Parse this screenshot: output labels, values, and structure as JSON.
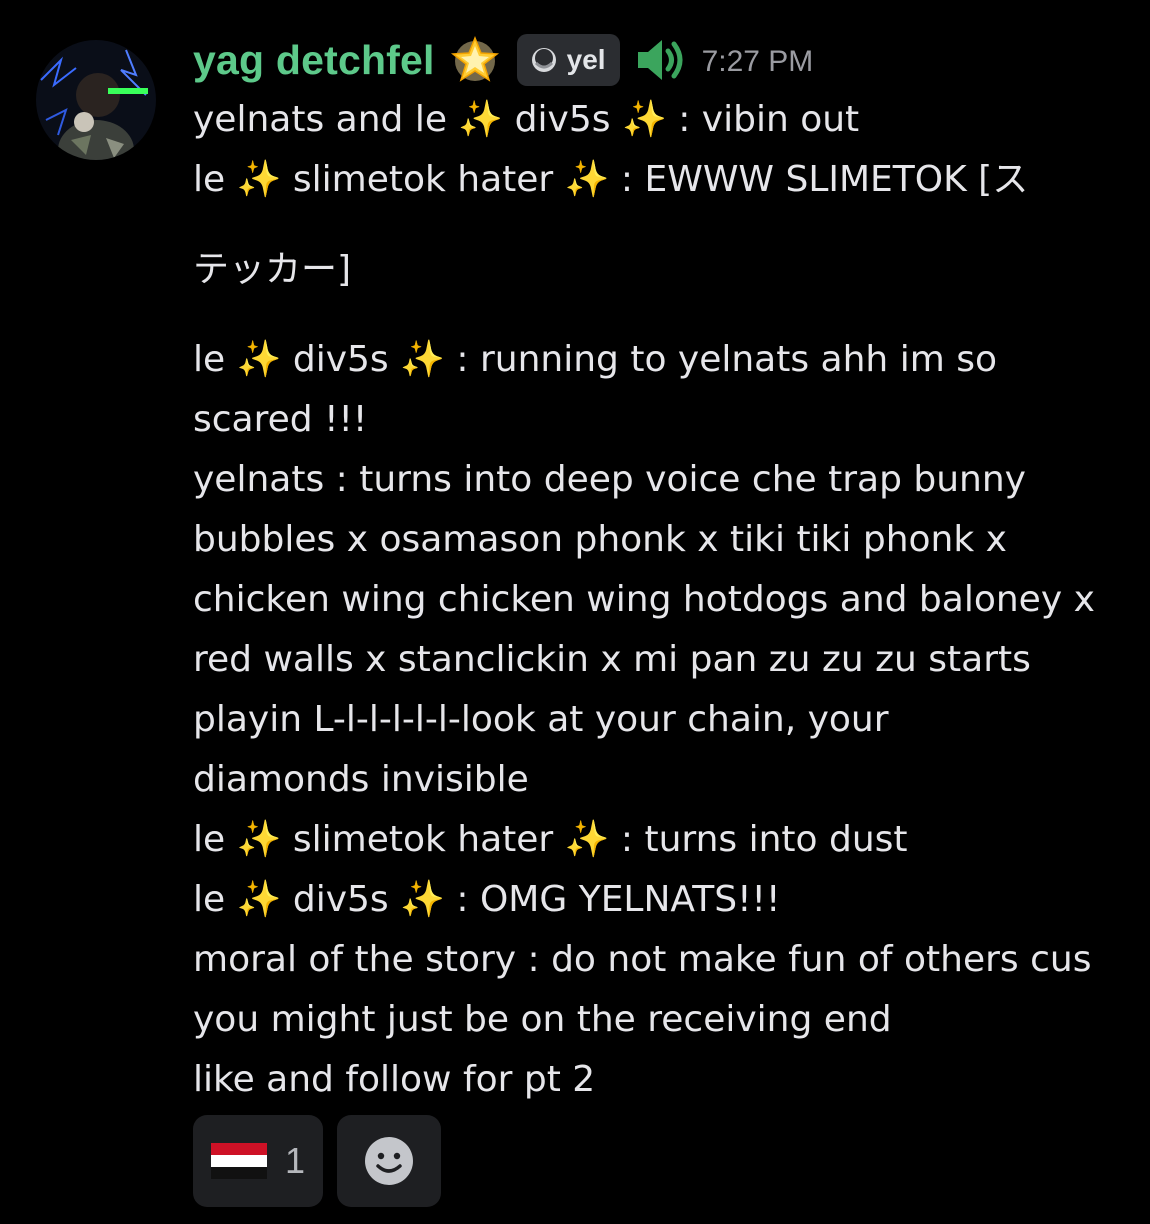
{
  "message": {
    "username": "yag detchfel",
    "username_color": "#5dc98a",
    "username_decoration_icon": "glowing-star-icon",
    "tag": {
      "icon": "guild-tag-icon",
      "label": "yel"
    },
    "status_icon": "speaker-icon",
    "timestamp": "7:27 PM",
    "lines": [
      "yelnats and le ✨ div5s ✨  : vibin out",
      "le ✨  slimetok hater ✨ : EWWW SLIMETOK [ス",
      "",
      "テッカー]",
      "",
      "le ✨ div5s ✨ : running to yelnats ahh im so",
      "scared !!!",
      "yelnats : turns into deep voice che trap bunny",
      "bubbles x osamason phonk x tiki tiki phonk x",
      "chicken wing chicken wing hotdogs and baloney x",
      "red walls x stanclickin x mi pan zu zu zu starts",
      "playin L-l-l-l-l-l-look at your chain, your",
      "diamonds invisible",
      "le ✨ slimetok hater ✨ : turns into dust",
      "le ✨ div5s ✨ : OMG YELNATS!!!",
      "moral of the story : do not make fun of others cus",
      "you might just be on the receiving end",
      "like and follow for pt 2"
    ]
  },
  "reactions": [
    {
      "icon": "yemen-flag-icon",
      "count": "1"
    },
    {
      "icon": "add-reaction-smile-icon"
    }
  ]
}
